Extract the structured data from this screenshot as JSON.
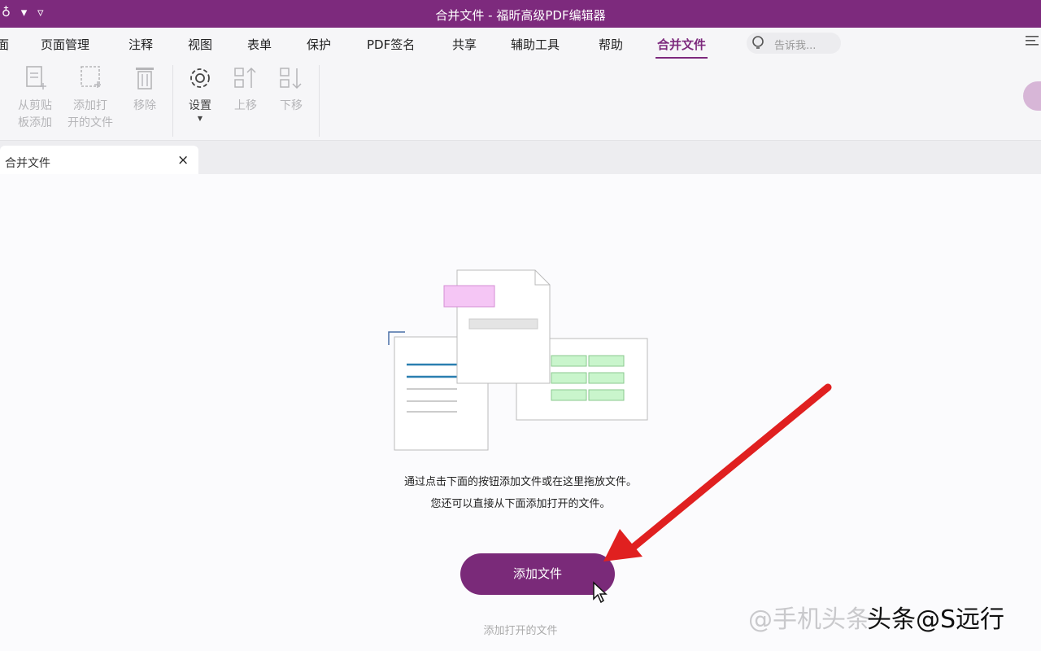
{
  "titlebar": {
    "title": "合并文件 - 福昕高级PDF编辑器",
    "quick_access": "♁ ▾ ▿"
  },
  "menu": {
    "items": [
      "页面管理",
      "注释",
      "视图",
      "表单",
      "保护",
      "PDF签名",
      "共享",
      "辅助工具",
      "帮助",
      "合并文件"
    ],
    "partial_left": "面",
    "active": "合并文件",
    "search_placeholder": "告诉我..."
  },
  "ribbon": {
    "paste_line1": "从剪贴",
    "paste_line2": "板添加",
    "open_line1": "添加打",
    "open_line2": "开的文件",
    "remove": "移除",
    "settings": "设置",
    "up": "上移",
    "down": "下移"
  },
  "tab": {
    "label": "合并文件",
    "close": "×"
  },
  "content": {
    "hint_line1": "通过点击下面的按钮添加文件或在这里拖放文件。",
    "hint_line2": "您还可以直接从下面添加打开的文件。",
    "add_button": "添加文件",
    "add_open": "添加打开的文件"
  },
  "watermark": "头条@S远行",
  "colors": {
    "brand": "#7d2a7d",
    "button": "#7a2a79",
    "arrow": "#e02020",
    "pink": "#f5c6f5",
    "green": "#c9f5cc",
    "blue": "#2a7fb0"
  }
}
